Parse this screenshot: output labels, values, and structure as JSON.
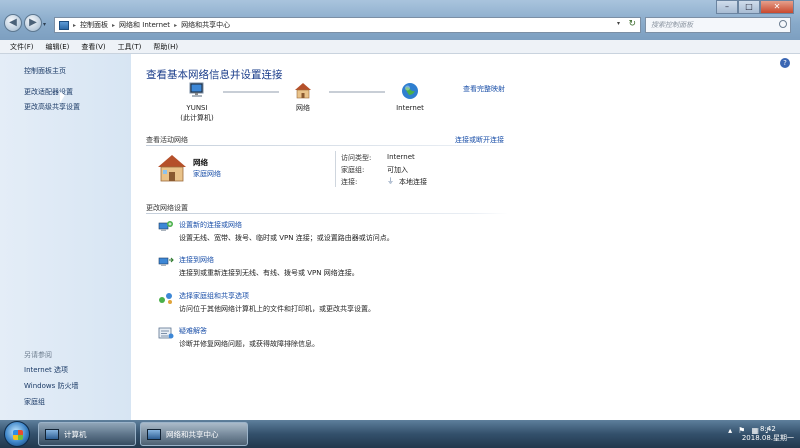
{
  "address_bar": {
    "crumbs": [
      "控制面板",
      "网络和 Internet",
      "网络和共享中心"
    ],
    "search_placeholder": "搜索控制面板"
  },
  "menubar": [
    "文件(F)",
    "编辑(E)",
    "查看(V)",
    "工具(T)",
    "帮助(H)"
  ],
  "sidebar": {
    "links": [
      "控制面板主页",
      "更改适配器设置",
      "更改高级共享设置"
    ],
    "see_also_heading": "另请参阅",
    "see_also": [
      "Internet 选项",
      "Windows 防火墙",
      "家庭组"
    ]
  },
  "main": {
    "title": "查看基本网络信息并设置连接",
    "full_map": "查看完整映射",
    "nodes": [
      {
        "label": "YUNSI",
        "sub": "(此计算机)"
      },
      {
        "label": "网络",
        "sub": ""
      },
      {
        "label": "Internet",
        "sub": ""
      }
    ],
    "active_title": "查看活动网络",
    "connect_link": "连接或断开连接",
    "network": {
      "name": "网络",
      "type": "家庭网络"
    },
    "props": [
      {
        "key": "访问类型:",
        "value": "Internet",
        "link": false
      },
      {
        "key": "家庭组:",
        "value": "可加入",
        "link": true
      },
      {
        "key": "连接:",
        "value": "本地连接",
        "link": true
      }
    ],
    "change_title": "更改网络设置",
    "tasks": [
      {
        "link": "设置新的连接或网络",
        "desc": "设置无线、宽带、拨号、临时或 VPN 连接；或设置路由器或访问点。"
      },
      {
        "link": "连接到网络",
        "desc": "连接到或重新连接到无线、有线、拨号或 VPN 网络连接。"
      },
      {
        "link": "选择家庭组和共享选项",
        "desc": "访问位于其他网络计算机上的文件和打印机，或更改共享设置。"
      },
      {
        "link": "疑难解答",
        "desc": "诊断并修复网络问题，或获得故障排除信息。"
      }
    ]
  },
  "taskbar": {
    "items": [
      "计算机",
      "网络和共享中心"
    ],
    "time": "8:42",
    "date": "2018.08.星期一"
  }
}
